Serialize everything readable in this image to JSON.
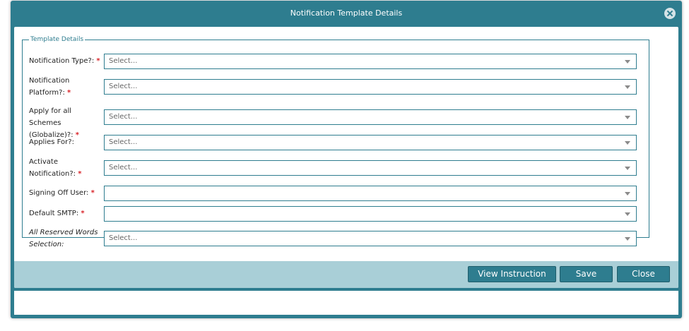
{
  "dialog": {
    "title": "Notification Template Details",
    "group_legend": "Template Details"
  },
  "fields": [
    {
      "label": "Notification Type?:",
      "required": "*",
      "value": "Select..."
    },
    {
      "label": "Notification Platform?:",
      "required": "*",
      "value": "Select..."
    },
    {
      "label": "Apply for all Schemes (Globalize)?:",
      "required": "*",
      "value": "Select..."
    },
    {
      "label": "Applies For?:",
      "required": "",
      "value": "Select..."
    },
    {
      "label": "Activate Notification?:",
      "required": "*",
      "value": "Select..."
    },
    {
      "label": "Signing Off User:",
      "required": "*",
      "value": ""
    },
    {
      "label": "Default SMTP:",
      "required": "*",
      "value": ""
    },
    {
      "label": "All Reserved Words Selection:",
      "required": "",
      "value": "Select..."
    }
  ],
  "buttons": {
    "view_instruction": "View Instruction",
    "save": "Save",
    "close": "Close"
  },
  "icons": {
    "close": "close-circle-icon",
    "dropdown": "chevron-down-icon"
  },
  "colors": {
    "accent": "#2e7d8f",
    "footer": "#a9cfd7",
    "required": "#d9252a"
  }
}
